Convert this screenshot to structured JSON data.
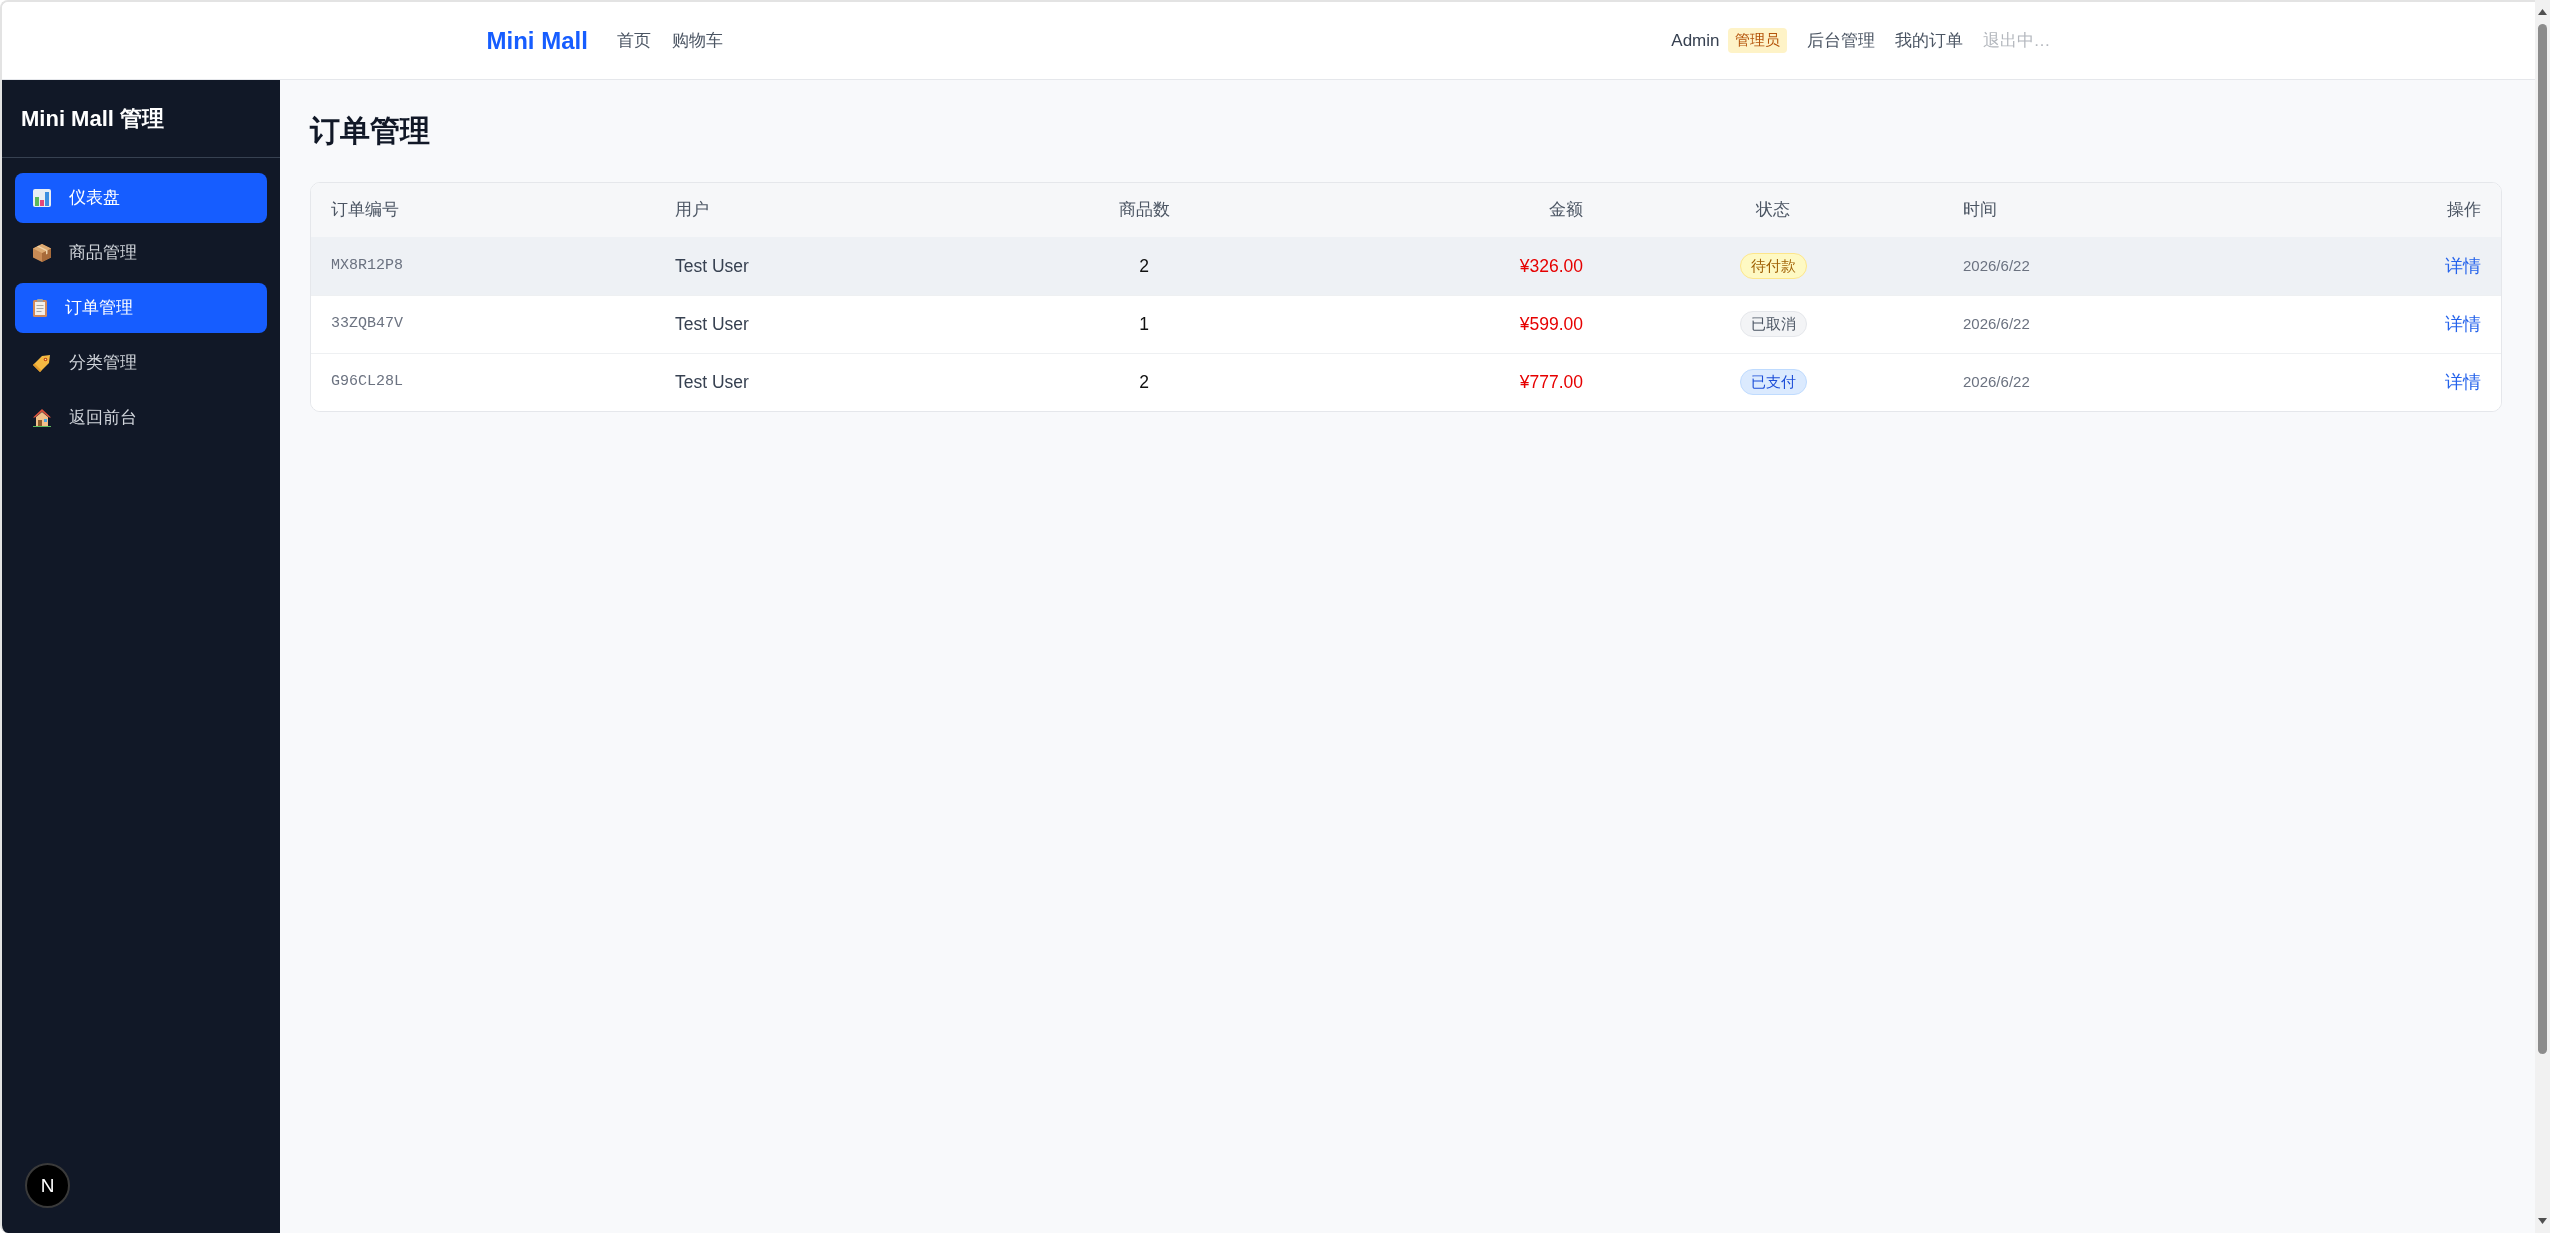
{
  "navbar": {
    "brand": "Mini Mall",
    "links": [
      {
        "label": "首页"
      },
      {
        "label": "购物车"
      }
    ],
    "user": {
      "name": "Admin",
      "role": "管理员"
    },
    "actions": [
      {
        "label": "后台管理",
        "disabled": false
      },
      {
        "label": "我的订单",
        "disabled": false
      },
      {
        "label": "退出中…",
        "disabled": true
      }
    ]
  },
  "sidebar": {
    "title": "Mini Mall 管理",
    "items": [
      {
        "label": "仪表盘",
        "kind": "dashboard",
        "selected": true
      },
      {
        "label": "商品管理",
        "kind": "products",
        "selected": false
      },
      {
        "label": "订单管理",
        "kind": "orders",
        "selected": true
      },
      {
        "label": "分类管理",
        "kind": "categories",
        "selected": false
      },
      {
        "label": "返回前台",
        "kind": "storefront",
        "selected": false
      }
    ],
    "dev_indicator": {
      "label": "N"
    }
  },
  "page": {
    "title": "订单管理"
  },
  "table": {
    "columns": [
      "订单编号",
      "用户",
      "商品数",
      "金额",
      "状态",
      "时间",
      "操作"
    ],
    "rows": [
      {
        "order_no": "MX8R12P8",
        "user": "Test User",
        "items": "2",
        "amount": "¥326.00",
        "status": {
          "label": "待付款",
          "kind": "pending"
        },
        "time": "2026/6/22",
        "action": "详情",
        "hovered": true
      },
      {
        "order_no": "33ZQB47V",
        "user": "Test User",
        "items": "1",
        "amount": "¥599.00",
        "status": {
          "label": "已取消",
          "kind": "cancelled"
        },
        "time": "2026/6/22",
        "action": "详情",
        "hovered": false
      },
      {
        "order_no": "G96CL28L",
        "user": "Test User",
        "items": "2",
        "amount": "¥777.00",
        "status": {
          "label": "已支付",
          "kind": "paid"
        },
        "time": "2026/6/22",
        "action": "详情",
        "hovered": false
      }
    ]
  }
}
